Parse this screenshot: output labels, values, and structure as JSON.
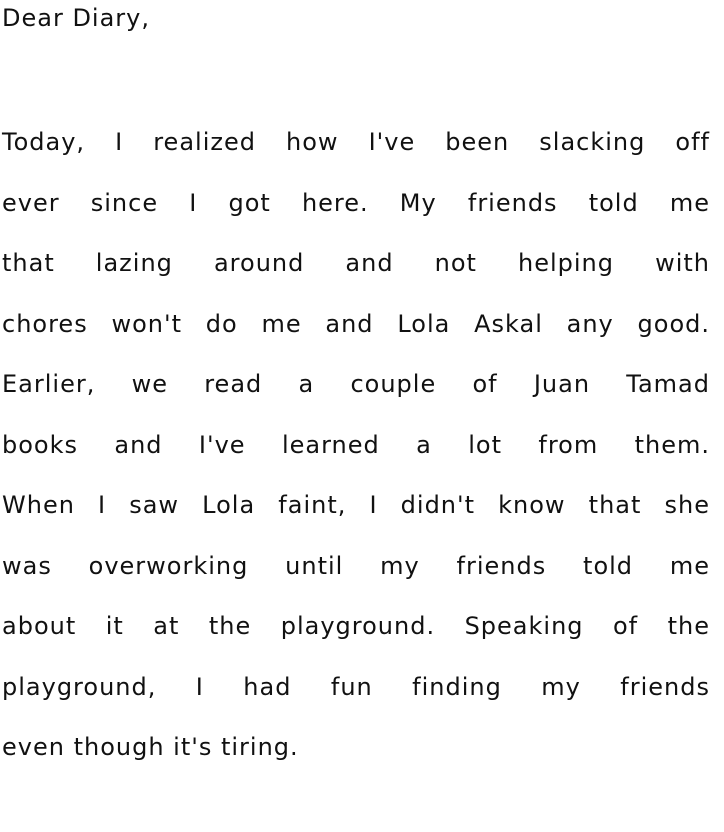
{
  "letter": {
    "greeting": "Dear Diary,",
    "lines": [
      "Today, I realized how I've been slacking off",
      "ever since I got here. My friends told me",
      "that lazing around and not helping with",
      "chores won't do me and Lola Askal any good.",
      "Earlier, we read a couple of Juan Tamad",
      "books and I've learned a lot from them.",
      "When I saw Lola faint, I didn't know that she",
      "was overworking until my friends told me",
      "about it at the playground. Speaking of the",
      "playground, I had fun finding my friends",
      "even though it's tiring."
    ]
  }
}
